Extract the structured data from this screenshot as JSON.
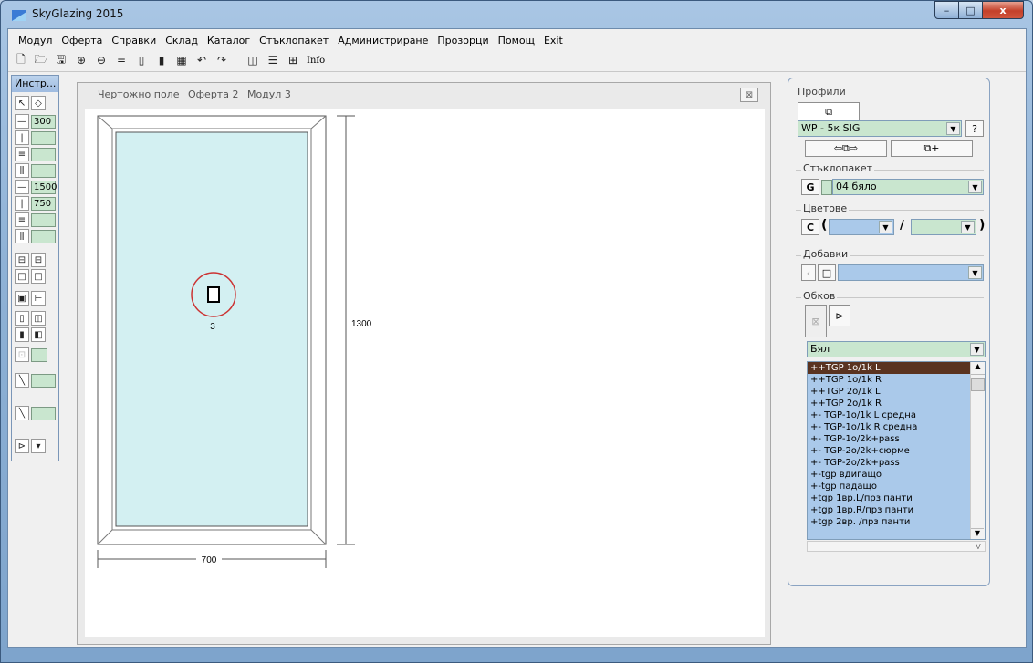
{
  "window": {
    "title": "SkyGlazing 2015",
    "min_label": "–",
    "max_label": "□",
    "close_label": "x"
  },
  "menu": [
    "Модул",
    "Оферта",
    "Справки",
    "Склад",
    "Каталог",
    "Стъклопакет",
    "Администриране",
    "Прозорци",
    "Помощ",
    "Exit"
  ],
  "toolbar": {
    "info_label": "Info"
  },
  "tools": {
    "title": "Инстр...",
    "field_width": "300",
    "field_a": "1500",
    "field_b": "750"
  },
  "drawing": {
    "breadcrumb": [
      "Чертожно поле",
      "Оферта 2",
      "Модул 3"
    ],
    "close_label": "⊠",
    "width_label": "700",
    "height_label": "1300",
    "sash_number": "3"
  },
  "profiles": {
    "section_title": "Профили",
    "selected_profile": "WP - 5к SIG",
    "help_label": "?",
    "glass_group": "Стъклопакет",
    "glass_button": "G",
    "glass_value": "04 бяло",
    "colors_group": "Цветове",
    "colors_button": "C",
    "colors_sep": "/",
    "additions_group": "Добавки",
    "fittings_group": "Обков",
    "fitting_color": "Бял",
    "fittings": [
      "++TGP 1o/1k L",
      "++TGP 1o/1k R",
      "++TGP 2o/1k L",
      "++TGP 2o/1k R",
      "+- TGP-1o/1k L средна",
      "+- TGP-1o/1k R средна",
      "+- TGP-1o/2k+pass",
      "+- TGP-2o/2k+сюрме",
      "+- TGP-2o/2k+pass",
      "+-tgp вдигащо",
      "+-tgp падащо",
      "+tgp 1вр.L/прз панти",
      "+tgp 1вр.R/прз панти",
      "+tgp 2вр.  /прз панти"
    ]
  },
  "colors": {
    "glass_fill": "#d3f0f2",
    "accent_green": "#c9e6cf",
    "list_blue": "#aac9ea",
    "selection": "#5a3320"
  }
}
